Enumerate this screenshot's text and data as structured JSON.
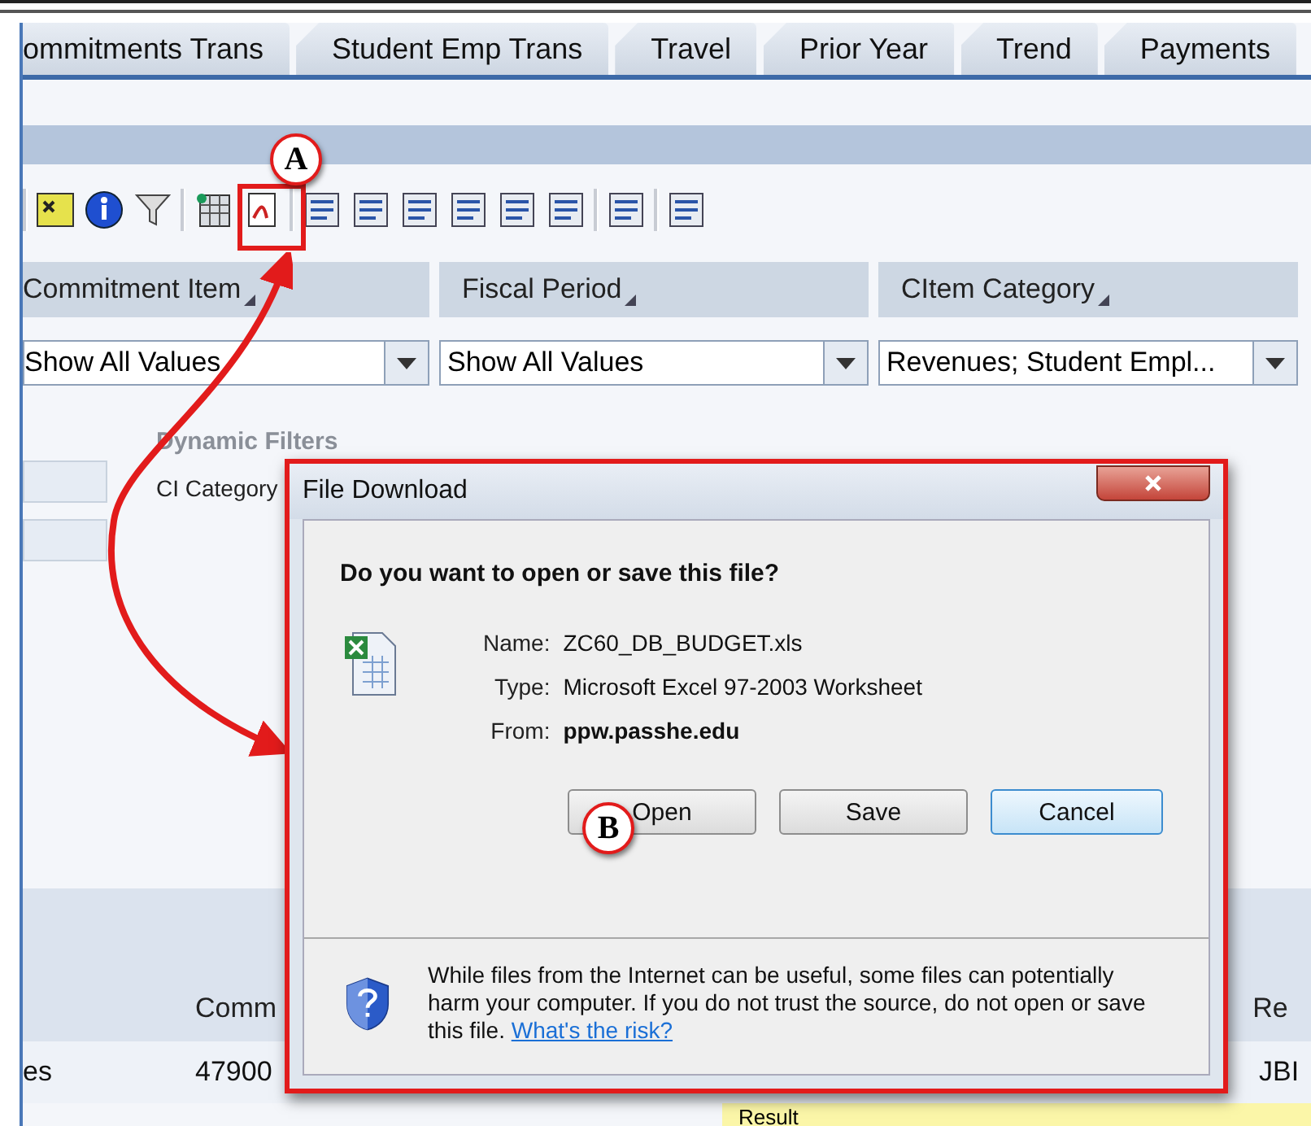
{
  "tabs": [
    {
      "label": "ommitments Trans"
    },
    {
      "label": "Student Emp Trans"
    },
    {
      "label": "Travel"
    },
    {
      "label": "Prior Year"
    },
    {
      "label": "Trend"
    },
    {
      "label": "Payments"
    }
  ],
  "filters": [
    {
      "heading": "Commitment Item",
      "value": "Show All Values"
    },
    {
      "heading": "Fiscal Period",
      "value": "Show All Values"
    },
    {
      "heading": "CItem Category",
      "value": "Revenues; Student Empl..."
    }
  ],
  "dynamic_filters": {
    "title": "Dynamic Filters",
    "label": "CI Category"
  },
  "table": {
    "columns": [
      "Comm",
      "Re"
    ],
    "row": [
      "es",
      "47900",
      "JBI"
    ],
    "result": "Result"
  },
  "callouts": [
    "A",
    "B"
  ],
  "dialog": {
    "title": "File Download",
    "question": "Do you want to open or save this file?",
    "fields": [
      {
        "label": "Name:",
        "value": "ZC60_DB_BUDGET.xls",
        "bold": false
      },
      {
        "label": "Type:",
        "value": "Microsoft Excel 97-2003 Worksheet",
        "bold": false
      },
      {
        "label": "From:",
        "value": "ppw.passhe.edu",
        "bold": true
      }
    ],
    "buttons": [
      {
        "label": "Open",
        "default": false
      },
      {
        "label": "Save",
        "default": false
      },
      {
        "label": "Cancel",
        "default": true
      }
    ],
    "warning": "While files from the Internet can be useful, some files can potentially harm your computer. If you do not trust the source, do not open or save this file.",
    "link": "What's the risk?"
  }
}
